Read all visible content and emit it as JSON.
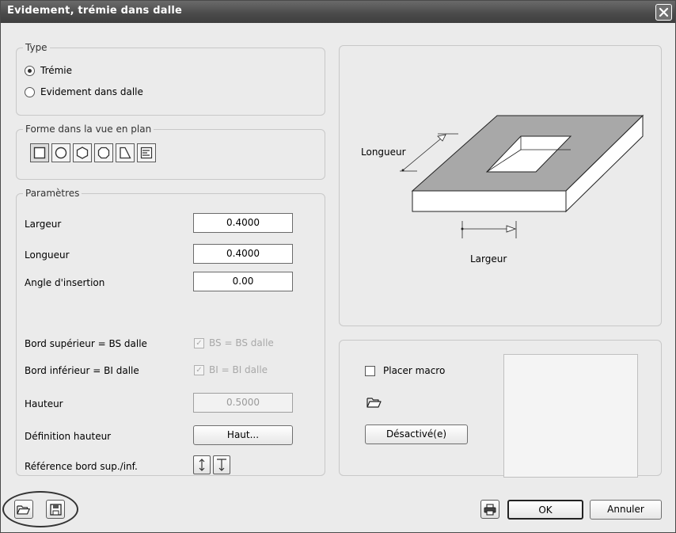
{
  "window": {
    "title": "Evidement, trémie dans dalle"
  },
  "type_group": {
    "legend": "Type",
    "options": [
      {
        "label": "Trémie",
        "selected": true
      },
      {
        "label": "Evidement dans dalle",
        "selected": false
      }
    ]
  },
  "shape_group": {
    "legend": "Forme dans la vue en plan",
    "shapes": [
      "rectangle-icon",
      "circle-icon",
      "hexagon-icon",
      "octagon-icon",
      "trapezoid-icon",
      "polyline-icon"
    ]
  },
  "params": {
    "legend": "Paramètres",
    "largeur_label": "Largeur",
    "largeur_value": "0.4000",
    "longueur_label": "Longueur",
    "longueur_value": "0.4000",
    "angle_label": "Angle d'insertion",
    "angle_value": "0.00",
    "bord_sup_label": "Bord supérieur = BS dalle",
    "bord_sup_check": "BS = BS dalle",
    "bord_inf_label": "Bord inférieur = BI dalle",
    "bord_inf_check": "BI = BI dalle",
    "hauteur_label": "Hauteur",
    "hauteur_value": "0.5000",
    "def_hauteur_label": "Définition hauteur",
    "def_hauteur_button": "Haut...",
    "reference_label": "Référence bord sup./inf."
  },
  "preview": {
    "longueur_label": "Longueur",
    "largeur_label": "Largeur"
  },
  "macro": {
    "checkbox_label": "Placer macro",
    "desactive_button": "Désactivé(e)"
  },
  "footer": {
    "ok": "OK",
    "annuler": "Annuler"
  }
}
